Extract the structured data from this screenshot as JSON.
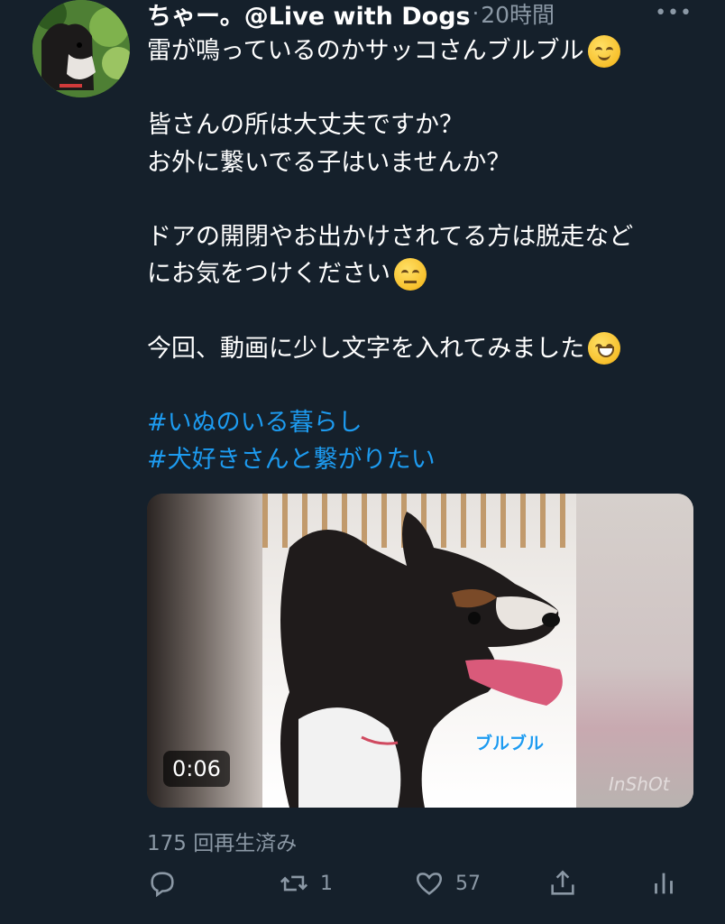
{
  "tweet": {
    "display_name": "ちゃー。@Live with Dogs",
    "separator": "·",
    "time": "20時間",
    "more_label": "•••",
    "lines": [
      {
        "text": "雷が鳴っているのかサッコさんブルブル",
        "emoji": "relieved-face-emoji"
      },
      {
        "text": ""
      },
      {
        "text": "皆さんの所は大丈夫ですか？"
      },
      {
        "text": "お外に繋いでる子はいませんか？"
      },
      {
        "text": ""
      },
      {
        "text": "ドアの開閉やお出かけされてる方は脱走など"
      },
      {
        "text": "にお気をつけください",
        "emoji": "confounded-face-emoji"
      },
      {
        "text": ""
      },
      {
        "text": "今回、動画に少し文字を入れてみました",
        "emoji": "grinning-squinting-face-emoji"
      },
      {
        "text": ""
      }
    ],
    "hashtags": [
      "#いぬのいる暮らし",
      "#犬好きさんと繋がりたい"
    ]
  },
  "media": {
    "duration": "0:06",
    "caption": "ブルブル",
    "watermark": "InShOt"
  },
  "views": "175 回再生済み",
  "actions": {
    "reply": {
      "icon": "reply-icon",
      "count": ""
    },
    "retweet": {
      "icon": "retweet-icon",
      "count": "1"
    },
    "like": {
      "icon": "heart-icon",
      "count": "57"
    },
    "share": {
      "icon": "share-icon",
      "count": ""
    },
    "analytics": {
      "icon": "analytics-icon",
      "count": ""
    }
  },
  "colors": {
    "background": "#15202b",
    "secondary_text": "#8b98a5",
    "link": "#1d9bf0"
  }
}
